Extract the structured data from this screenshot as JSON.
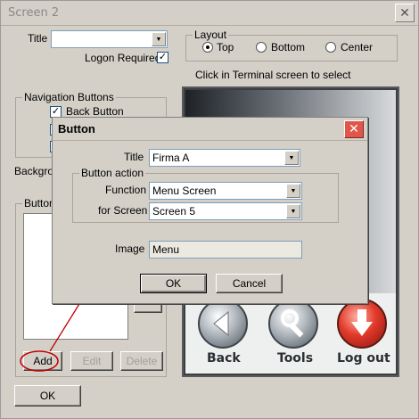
{
  "window": {
    "title": "Screen 2"
  },
  "title_field": {
    "label": "Title",
    "value": ""
  },
  "logon_required": {
    "label": "Logon Required",
    "checked": true
  },
  "layout": {
    "label": "Layout",
    "options": [
      "Top",
      "Bottom",
      "Center"
    ],
    "selected": "Top"
  },
  "terminal_hint": "Click in Terminal screen to select",
  "navigation": {
    "label": "Navigation Buttons",
    "items": [
      {
        "label": "Back Button",
        "checked": true
      },
      {
        "label": "",
        "checked": false
      },
      {
        "label": "",
        "checked": false
      }
    ]
  },
  "background_label": "Backgro",
  "buttons_group": {
    "label": "Buttons",
    "add_label": "Add",
    "edit_label": "Edit",
    "delete_label": "Delete"
  },
  "ok_label": "OK",
  "terminal_buttons": [
    "Back",
    "Tools",
    "Log out"
  ],
  "dialog": {
    "title": "Button",
    "title_label": "Title",
    "title_value": "Firma A",
    "action_label": "Button action",
    "function_label": "Function",
    "function_value": "Menu Screen",
    "for_screen_label": "for Screen",
    "for_screen_value": "Screen 5",
    "image_label": "Image",
    "image_value": "Menu",
    "ok_label": "OK",
    "cancel_label": "Cancel"
  },
  "colors": {
    "window_bg": "#d4d0c8",
    "annotation": "#c00000",
    "close_red": "#e0564a"
  },
  "icons": [
    "close-icon",
    "dropdown-arrow-icon",
    "back-arrow-icon",
    "tools-wrench-icon",
    "logout-arrow-icon"
  ]
}
